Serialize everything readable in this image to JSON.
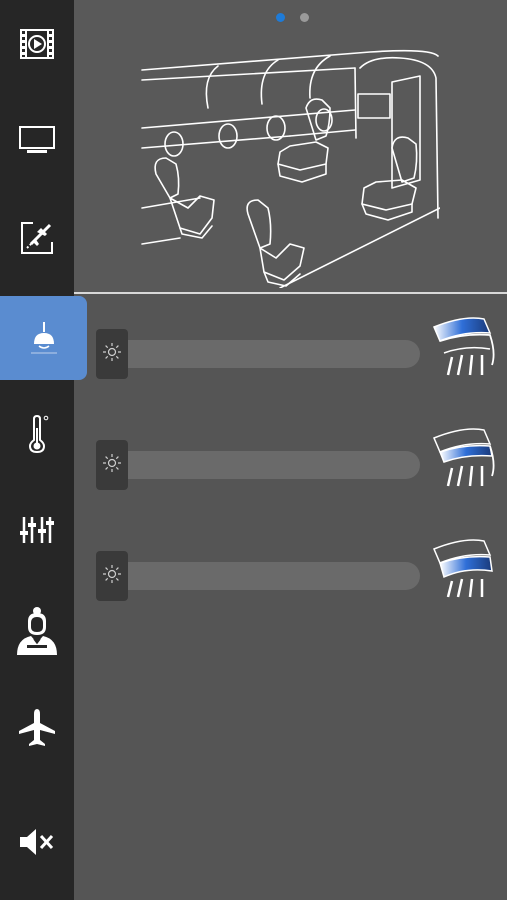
{
  "sidebar": {
    "items": [
      {
        "name": "media-icon",
        "active": false
      },
      {
        "name": "display-icon",
        "active": false
      },
      {
        "name": "flight-map-icon",
        "active": false
      },
      {
        "name": "lighting-icon",
        "active": true
      },
      {
        "name": "thermometer-icon",
        "active": false
      },
      {
        "name": "sliders-icon",
        "active": false
      },
      {
        "name": "flight-attendant-icon",
        "active": false
      },
      {
        "name": "airplane-icon",
        "active": false
      },
      {
        "name": "mute-icon",
        "active": false
      }
    ]
  },
  "pager": {
    "pages": 2,
    "current": 1
  },
  "colors": {
    "accent": "#5a8cd0",
    "pager_active": "#1e7bd8",
    "sidebar_bg": "#262626",
    "content_bg": "#555555"
  },
  "lighting": {
    "zones": [
      {
        "zone": "upper",
        "level": 0
      },
      {
        "zone": "middle",
        "level": 0
      },
      {
        "zone": "lower",
        "level": 0
      }
    ]
  }
}
